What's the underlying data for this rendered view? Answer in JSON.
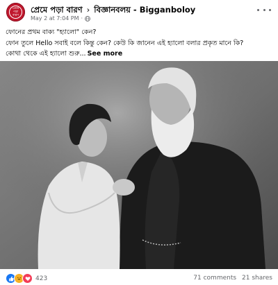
{
  "header": {
    "page_name": "প্রেমে পড়া বারণ",
    "separator": "›",
    "group_name": "বিজ্ঞানবলয় - Bigganboloy",
    "avatar_text": "প্রেমে পড়া বারণ",
    "timestamp": "May 2 at 7:04 PM",
    "dot": "·",
    "privacy_icon": "globe-icon",
    "more_icon": "more-options-icon"
  },
  "post": {
    "line1": "ফোনের প্রথম বাক্য \"হ্যালো\" কেন?",
    "line2": "ফোন তুলে Hello সবাই বলে কিন্তু কেন? কেউ কি জানেন এই হ্যালো বলার প্রকৃত মানে কি?",
    "line3": "কোথা থেকে এই হ্যালো শুরু...",
    "see_more": "See more"
  },
  "photo": {
    "subject": "black-and-white-photo",
    "tone_dark": "#1d1d1d",
    "tone_light": "#d9d9d9"
  },
  "footer": {
    "reaction_icons": [
      "like-icon",
      "haha-icon",
      "love-icon"
    ],
    "reaction_count": "423",
    "comments": "71 comments",
    "shares": "21 shares"
  },
  "colors": {
    "meta_gray": "#65676b",
    "like_blue": "#1877f2",
    "love_red": "#f33e58",
    "haha_yellow": "#f7b125",
    "avatar_red": "#c0182d"
  }
}
